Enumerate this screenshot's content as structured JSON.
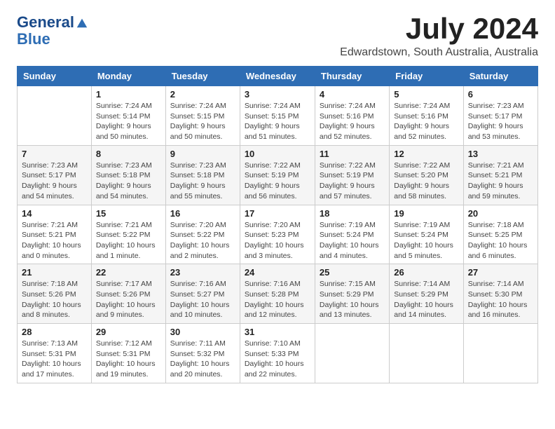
{
  "header": {
    "logo_line1": "General",
    "logo_line2": "Blue",
    "month_year": "July 2024",
    "location": "Edwardstown, South Australia, Australia"
  },
  "weekdays": [
    "Sunday",
    "Monday",
    "Tuesday",
    "Wednesday",
    "Thursday",
    "Friday",
    "Saturday"
  ],
  "weeks": [
    [
      {
        "day": "",
        "info": ""
      },
      {
        "day": "1",
        "info": "Sunrise: 7:24 AM\nSunset: 5:14 PM\nDaylight: 9 hours\nand 50 minutes."
      },
      {
        "day": "2",
        "info": "Sunrise: 7:24 AM\nSunset: 5:15 PM\nDaylight: 9 hours\nand 50 minutes."
      },
      {
        "day": "3",
        "info": "Sunrise: 7:24 AM\nSunset: 5:15 PM\nDaylight: 9 hours\nand 51 minutes."
      },
      {
        "day": "4",
        "info": "Sunrise: 7:24 AM\nSunset: 5:16 PM\nDaylight: 9 hours\nand 52 minutes."
      },
      {
        "day": "5",
        "info": "Sunrise: 7:24 AM\nSunset: 5:16 PM\nDaylight: 9 hours\nand 52 minutes."
      },
      {
        "day": "6",
        "info": "Sunrise: 7:23 AM\nSunset: 5:17 PM\nDaylight: 9 hours\nand 53 minutes."
      }
    ],
    [
      {
        "day": "7",
        "info": "Sunrise: 7:23 AM\nSunset: 5:17 PM\nDaylight: 9 hours\nand 54 minutes."
      },
      {
        "day": "8",
        "info": "Sunrise: 7:23 AM\nSunset: 5:18 PM\nDaylight: 9 hours\nand 54 minutes."
      },
      {
        "day": "9",
        "info": "Sunrise: 7:23 AM\nSunset: 5:18 PM\nDaylight: 9 hours\nand 55 minutes."
      },
      {
        "day": "10",
        "info": "Sunrise: 7:22 AM\nSunset: 5:19 PM\nDaylight: 9 hours\nand 56 minutes."
      },
      {
        "day": "11",
        "info": "Sunrise: 7:22 AM\nSunset: 5:19 PM\nDaylight: 9 hours\nand 57 minutes."
      },
      {
        "day": "12",
        "info": "Sunrise: 7:22 AM\nSunset: 5:20 PM\nDaylight: 9 hours\nand 58 minutes."
      },
      {
        "day": "13",
        "info": "Sunrise: 7:21 AM\nSunset: 5:21 PM\nDaylight: 9 hours\nand 59 minutes."
      }
    ],
    [
      {
        "day": "14",
        "info": "Sunrise: 7:21 AM\nSunset: 5:21 PM\nDaylight: 10 hours\nand 0 minutes."
      },
      {
        "day": "15",
        "info": "Sunrise: 7:21 AM\nSunset: 5:22 PM\nDaylight: 10 hours\nand 1 minute."
      },
      {
        "day": "16",
        "info": "Sunrise: 7:20 AM\nSunset: 5:22 PM\nDaylight: 10 hours\nand 2 minutes."
      },
      {
        "day": "17",
        "info": "Sunrise: 7:20 AM\nSunset: 5:23 PM\nDaylight: 10 hours\nand 3 minutes."
      },
      {
        "day": "18",
        "info": "Sunrise: 7:19 AM\nSunset: 5:24 PM\nDaylight: 10 hours\nand 4 minutes."
      },
      {
        "day": "19",
        "info": "Sunrise: 7:19 AM\nSunset: 5:24 PM\nDaylight: 10 hours\nand 5 minutes."
      },
      {
        "day": "20",
        "info": "Sunrise: 7:18 AM\nSunset: 5:25 PM\nDaylight: 10 hours\nand 6 minutes."
      }
    ],
    [
      {
        "day": "21",
        "info": "Sunrise: 7:18 AM\nSunset: 5:26 PM\nDaylight: 10 hours\nand 8 minutes."
      },
      {
        "day": "22",
        "info": "Sunrise: 7:17 AM\nSunset: 5:26 PM\nDaylight: 10 hours\nand 9 minutes."
      },
      {
        "day": "23",
        "info": "Sunrise: 7:16 AM\nSunset: 5:27 PM\nDaylight: 10 hours\nand 10 minutes."
      },
      {
        "day": "24",
        "info": "Sunrise: 7:16 AM\nSunset: 5:28 PM\nDaylight: 10 hours\nand 12 minutes."
      },
      {
        "day": "25",
        "info": "Sunrise: 7:15 AM\nSunset: 5:29 PM\nDaylight: 10 hours\nand 13 minutes."
      },
      {
        "day": "26",
        "info": "Sunrise: 7:14 AM\nSunset: 5:29 PM\nDaylight: 10 hours\nand 14 minutes."
      },
      {
        "day": "27",
        "info": "Sunrise: 7:14 AM\nSunset: 5:30 PM\nDaylight: 10 hours\nand 16 minutes."
      }
    ],
    [
      {
        "day": "28",
        "info": "Sunrise: 7:13 AM\nSunset: 5:31 PM\nDaylight: 10 hours\nand 17 minutes."
      },
      {
        "day": "29",
        "info": "Sunrise: 7:12 AM\nSunset: 5:31 PM\nDaylight: 10 hours\nand 19 minutes."
      },
      {
        "day": "30",
        "info": "Sunrise: 7:11 AM\nSunset: 5:32 PM\nDaylight: 10 hours\nand 20 minutes."
      },
      {
        "day": "31",
        "info": "Sunrise: 7:10 AM\nSunset: 5:33 PM\nDaylight: 10 hours\nand 22 minutes."
      },
      {
        "day": "",
        "info": ""
      },
      {
        "day": "",
        "info": ""
      },
      {
        "day": "",
        "info": ""
      }
    ]
  ]
}
